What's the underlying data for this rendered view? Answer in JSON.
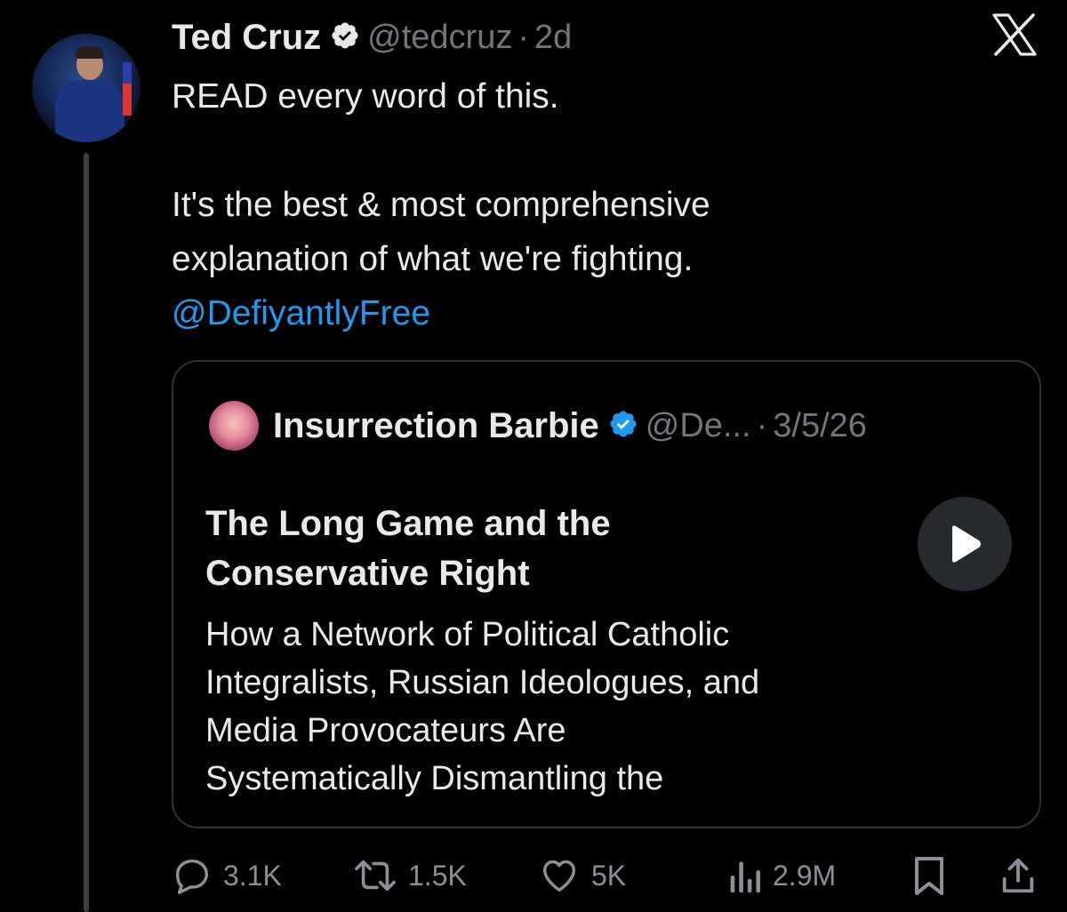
{
  "tweet": {
    "display_name": "Ted Cruz",
    "handle": "@tedcruz",
    "separator": "·",
    "time": "2d",
    "text_line1": "READ every word of this.",
    "text_line2": "It's the best & most comprehensive",
    "text_line3": "explanation of what we're fighting.",
    "mention": "@DefiyantlyFree"
  },
  "quote": {
    "display_name": "Insurrection Barbie",
    "handle": "@De...",
    "separator": "·",
    "date": "3/5/26",
    "title_line1": "The Long Game and the",
    "title_line2": "Conservative Right",
    "desc_line1": "How a Network of Political Catholic",
    "desc_line2": "Integralists, Russian Ideologues, and",
    "desc_line3": "Media Provocateurs Are",
    "desc_line4": "Systematically Dismantling the"
  },
  "actions": {
    "replies": "3.1K",
    "reposts": "1.5K",
    "likes": "5K",
    "views": "2.9M"
  },
  "icons": {
    "verified": "verified-badge-icon",
    "app": "x-logo-icon",
    "play": "play-icon",
    "reply": "reply-icon",
    "repost": "repost-icon",
    "like": "heart-icon",
    "views": "views-icon",
    "bookmark": "bookmark-icon",
    "share": "share-icon"
  },
  "colors": {
    "background": "#000000",
    "text": "#e7e9ea",
    "secondary": "#71767b",
    "link": "#1d9bf0",
    "verified": "#1d9bf0"
  }
}
